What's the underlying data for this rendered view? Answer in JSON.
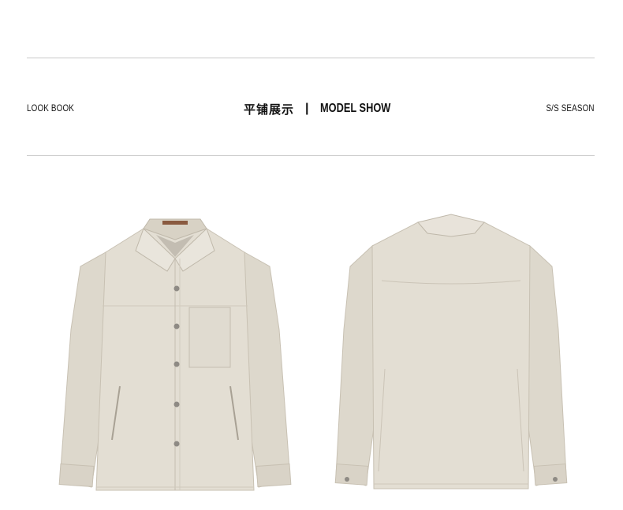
{
  "header": {
    "left_label": "LOOK BOOK",
    "center_cn": "平铺展示",
    "center_divider": "|",
    "center_en": "MODEL SHOW",
    "right_label": "S/S SEASON"
  },
  "products": {
    "front_view": {
      "icon": "jacket-front-image"
    },
    "back_view": {
      "icon": "jacket-back-image"
    }
  },
  "colors": {
    "fabric": "#e3ded3",
    "fabric_shade": "#d3cdc0",
    "seam": "#bfb8aa",
    "button": "#8e8a84",
    "rule": "#c9c9c9"
  }
}
